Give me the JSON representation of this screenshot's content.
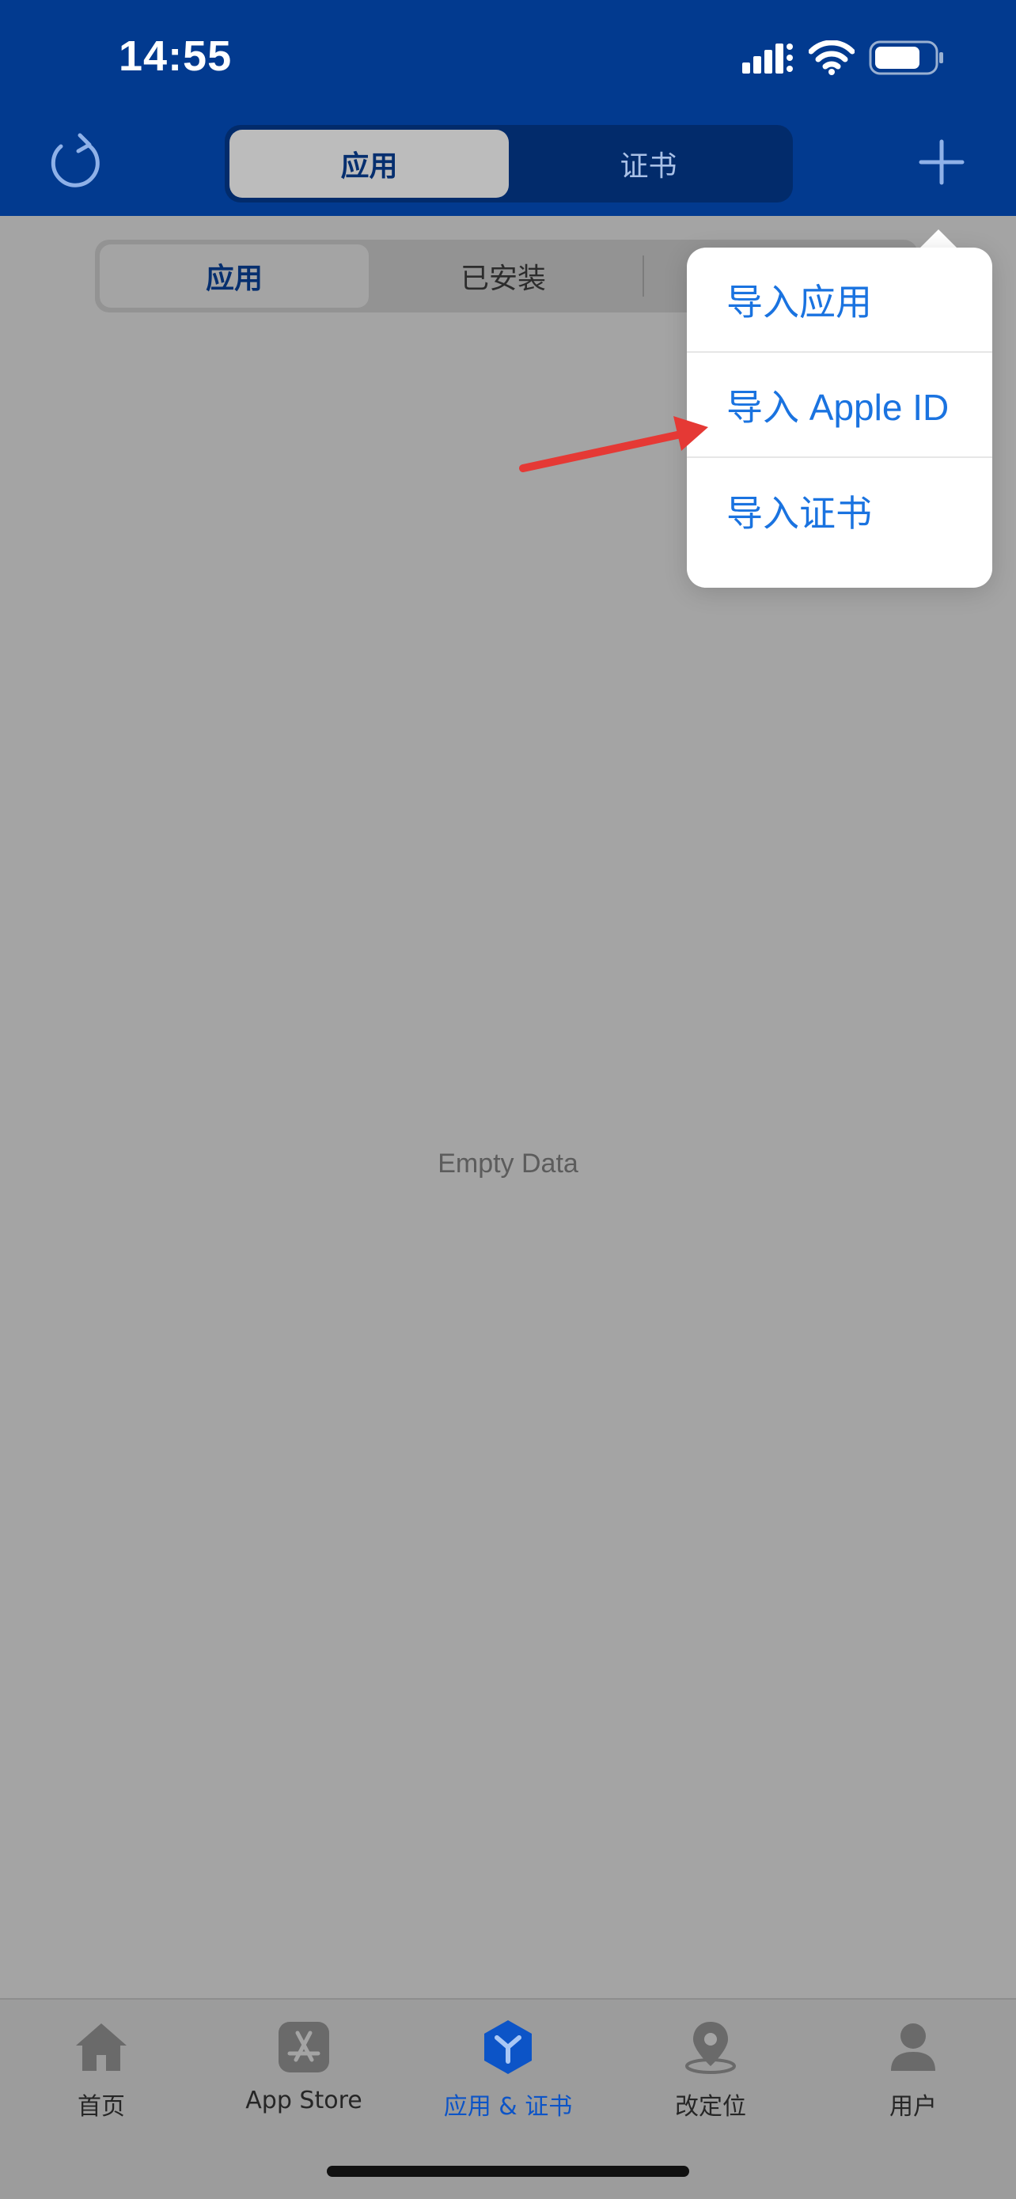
{
  "status_bar": {
    "time": "14:55"
  },
  "header": {
    "tabs": [
      {
        "label": "应用",
        "active": true
      },
      {
        "label": "证书",
        "active": false
      }
    ],
    "refresh_icon": "refresh-icon",
    "add_icon": "plus-icon"
  },
  "sub_tabs": [
    {
      "label": "应用",
      "active": true
    },
    {
      "label": "已安装",
      "active": false
    }
  ],
  "popover": {
    "items": [
      {
        "label": "导入应用"
      },
      {
        "label": "导入 Apple ID"
      },
      {
        "label": "导入证书"
      }
    ]
  },
  "empty_state": {
    "text": "Empty Data"
  },
  "tabbar": {
    "items": [
      {
        "label": "首页",
        "icon": "home-icon",
        "active": false
      },
      {
        "label": "App Store",
        "icon": "app-store-icon",
        "active": false
      },
      {
        "label": "应用 & 证书",
        "icon": "apps-certificates-icon",
        "active": true
      },
      {
        "label": "改定位",
        "icon": "location-pin-icon",
        "active": false
      },
      {
        "label": "用户",
        "icon": "user-icon",
        "active": false
      }
    ]
  },
  "colors": {
    "header_bg": "#023a8f",
    "accent": "#1a73e0",
    "overlay_bg": "#a4a4a4",
    "annotation_arrow": "#e53935"
  }
}
